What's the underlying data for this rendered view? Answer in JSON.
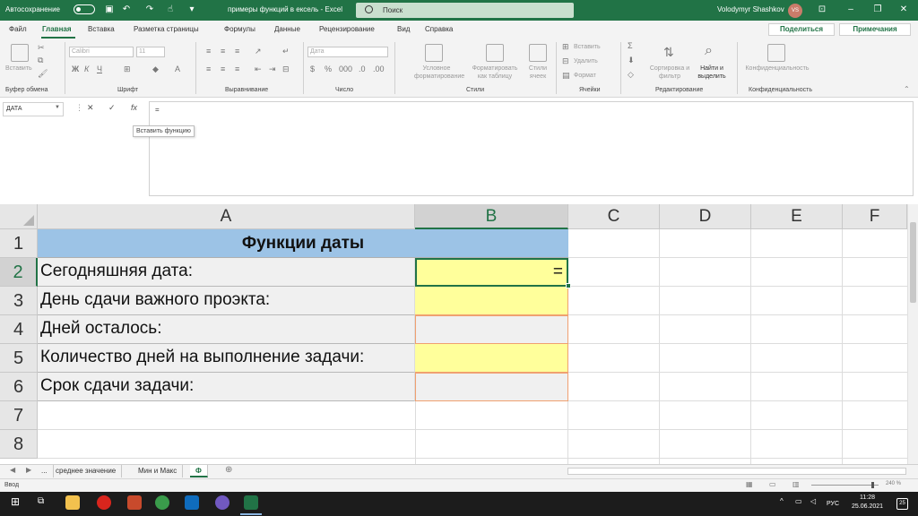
{
  "titlebar": {
    "autosave_label": "Автосохранение",
    "doc_title": "примеры функций в ексель  -  Excel",
    "search_placeholder": "Поиск",
    "user_name": "Volodymyr Shashkov",
    "user_initials": "VS"
  },
  "ribbon_tabs": [
    "Файл",
    "Главная",
    "Вставка",
    "Разметка страницы",
    "Формулы",
    "Данные",
    "Рецензирование",
    "Вид",
    "Справка"
  ],
  "share_label": "Поделиться",
  "notes_label": "Примечания",
  "ribbon": {
    "groups": [
      "Буфер обмена",
      "Шрифт",
      "Выравнивание",
      "Число",
      "Стили",
      "Ячейки",
      "Редактирование",
      "Конфиденциальность"
    ],
    "paste_label": "Вставить",
    "font_name": "Calibri",
    "font_size": "11",
    "number_format": "Дата",
    "cond_format": "Условное форматирование",
    "format_table": "Форматировать как таблицу",
    "cell_styles": "Стили ячеек",
    "insert_label": "Вставить",
    "delete_label": "Удалить",
    "format_label": "Формат",
    "sort_filter": "Сортировка и фильтр",
    "find_select": "Найти и выделить",
    "sensitivity": "Конфиденциальность"
  },
  "formula_bar": {
    "name_box": "ДАТА",
    "formula": "=",
    "tooltip": "Вставить функцию"
  },
  "grid": {
    "columns": [
      "A",
      "B",
      "C",
      "D",
      "E",
      "F"
    ],
    "rows": [
      "1",
      "2",
      "3",
      "4",
      "5",
      "6",
      "7",
      "8"
    ],
    "header_title": "Функции даты",
    "labels": [
      "Сегодняшняя дата:",
      "День сдачи важного проэкта:",
      "Дней осталось:",
      "Количество дней на выполнение задачи:",
      "Срок сдачи задачи:"
    ],
    "active_value": "="
  },
  "sheets": {
    "tabs": [
      "...",
      "среднее значение",
      "Мин и Макс",
      "Ф"
    ]
  },
  "status": {
    "mode": "Ввод",
    "zoom": "240 %"
  },
  "taskbar": {
    "lang": "РУС",
    "time": "11:28",
    "date": "25.06.2021",
    "notif": "25"
  },
  "colors": {
    "accent": "#217346",
    "header_fill": "#9cc3e6",
    "yellow": "#ffff9b",
    "gray_cell": "#f0f0f0"
  }
}
